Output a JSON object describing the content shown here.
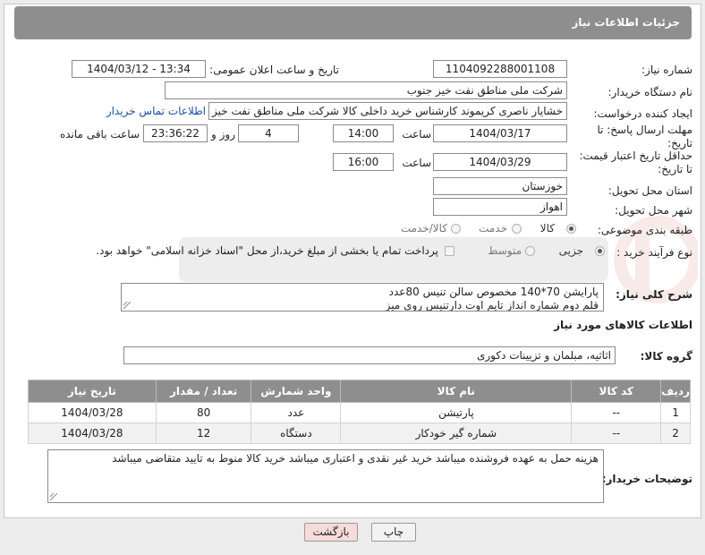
{
  "header": {
    "title": "جزئیات اطلاعات نیاز"
  },
  "need_number": {
    "label": "شماره نیاز:",
    "value": "1104092288001108"
  },
  "announce": {
    "label": "تاریخ و ساعت اعلان عمومی:",
    "value": "1404/03/12 - 13:34"
  },
  "buyer_org": {
    "label": "نام دستگاه خریدار:",
    "value": "شرکت ملی مناطق نفت خیز جنوب"
  },
  "requester": {
    "label": "ایجاد کننده درخواست:",
    "value": "خشایار ناصری کریموند کارشناس خرید داخلی کالا  شرکت ملی مناطق نفت خیز",
    "contact_link": "اطلاعات تماس خریدار"
  },
  "send_deadline": {
    "label_line1": "مهلت ارسال پاسخ: تا",
    "label_line2": "تاریخ:",
    "date": "1404/03/17",
    "time_label": "ساعت",
    "time": "14:00",
    "days": "4",
    "days_label": "روز و",
    "remaining": "23:36:22",
    "remaining_label": "ساعت باقی مانده"
  },
  "price_validity": {
    "label_line1": "حداقل تاریخ اعتبار قیمت:",
    "label_line2": "تا تاریخ:",
    "date": "1404/03/29",
    "time_label": "ساعت",
    "time": "16:00"
  },
  "province": {
    "label": "استان محل تحویل:",
    "value": "خوزستان"
  },
  "city": {
    "label": "شهر محل تحویل:",
    "value": "اهواز"
  },
  "category": {
    "label": "طبقه بندی موضوعی:",
    "options": [
      "کالا",
      "خدمت",
      "کالا/خدمت"
    ],
    "selected": "کالا"
  },
  "process": {
    "label": "نوع فرآیند خرید :",
    "options": [
      "جزیی",
      "متوسط"
    ],
    "selected": "جزیی",
    "payment_note": "پرداخت تمام یا بخشی از مبلغ خرید،از محل \"اسناد خزانه اسلامی\" خواهد بود."
  },
  "description": {
    "label": "شرح کلی نیاز:",
    "line1": "پارایشن 70*140 مخصوص سالن تنیس 80عدد",
    "line2": "قلم دوم شماره انداز تایم اوت دارتنیس روی میز"
  },
  "goods_section_title": "اطلاعات کالاهای مورد نیاز",
  "goods_group": {
    "label": "گروه کالا:",
    "value": "اثاثیه، مبلمان و تزیینات دکوری"
  },
  "table": {
    "headers": [
      "ردیف",
      "کد کالا",
      "نام کالا",
      "واحد شمارش",
      "تعداد / مقدار",
      "تاریخ نیاز"
    ],
    "rows": [
      [
        "1",
        "--",
        "پارتیشن",
        "عدد",
        "80",
        "1404/03/28"
      ],
      [
        "2",
        "--",
        "شماره گیر خودکار",
        "دستگاه",
        "12",
        "1404/03/28"
      ]
    ]
  },
  "buyer_notes": {
    "label": "توضیحات خریدار:",
    "value": "هزینه حمل به عهده فروشنده میباشد خرید غیر نقدی و اعتباری میباشد خرید کالا منوط به تایید متقاضی میباشد"
  },
  "buttons": {
    "print": "چاپ",
    "back": "بازگشت"
  },
  "colors": {
    "header_bg": "#8e8e8e",
    "link": "#1a4fa0",
    "back_button_bg": "#f7dada"
  }
}
